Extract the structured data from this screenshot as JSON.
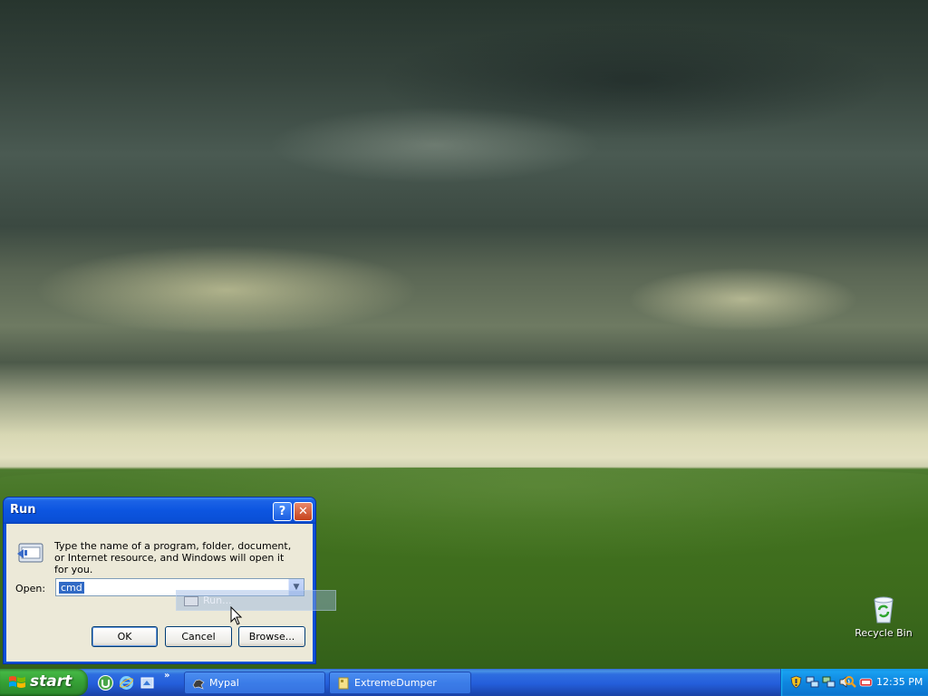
{
  "desktop": {
    "recycle_bin_label": "Recycle Bin"
  },
  "run_dialog": {
    "title": "Run",
    "help_glyph": "?",
    "close_glyph": "✕",
    "description": "Type the name of a program, folder, document, or Internet resource, and Windows will open it for you.",
    "open_label": "Open:",
    "open_value": "cmd",
    "ok_label": "OK",
    "cancel_label": "Cancel",
    "browse_label": "Browse..."
  },
  "drag_ghost": {
    "label": "Run..."
  },
  "taskbar": {
    "start_label": "start",
    "quick_launch_chevron": "»",
    "tasks": [
      {
        "label": "Mypal",
        "icon": "mypal-icon"
      },
      {
        "label": "ExtremeDumper",
        "icon": "folder-icon"
      }
    ],
    "tray": {
      "time": "12:35 PM",
      "icons": [
        "shield-icon",
        "network-icon",
        "network-icon",
        "volume-icon",
        "search-icon",
        "antivirus-icon"
      ]
    }
  },
  "colors": {
    "taskbar_blue": "#245edb",
    "start_green": "#35a035",
    "dialog_face": "#ece9d8",
    "selection_blue": "#316ac5"
  }
}
